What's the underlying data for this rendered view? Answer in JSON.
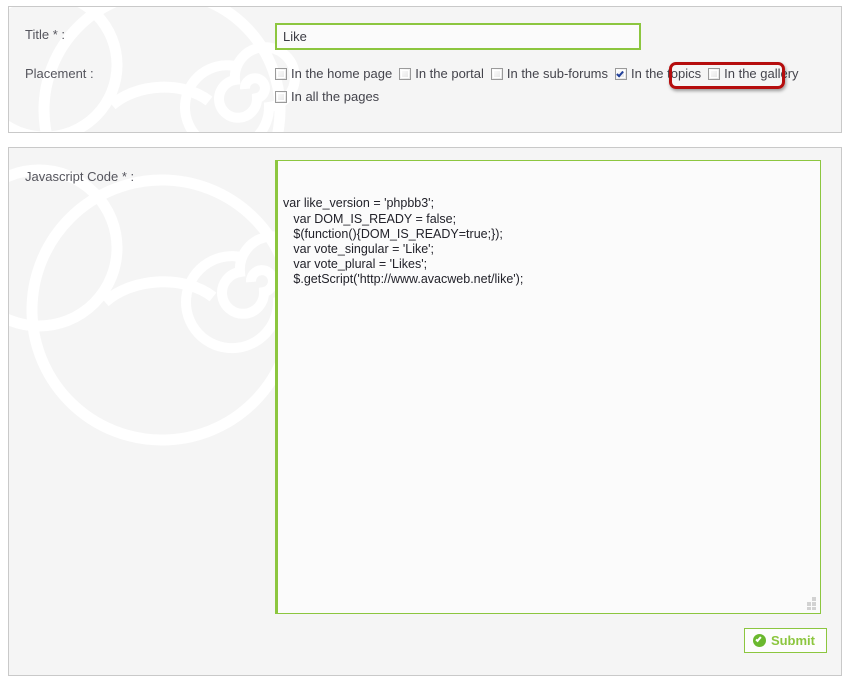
{
  "form": {
    "title_label": "Title * :",
    "title_value": "Like",
    "title_placeholder": "",
    "placement_label": "Placement :",
    "placement_options": [
      {
        "label": "In the home page",
        "checked": false
      },
      {
        "label": "In the portal",
        "checked": false
      },
      {
        "label": "In the sub-forums",
        "checked": false
      },
      {
        "label": "In the topics",
        "checked": true
      },
      {
        "label": "In the gallery",
        "checked": false
      },
      {
        "label": "In all the pages",
        "checked": false
      }
    ],
    "code_label": "Javascript Code * :",
    "code_value": "var like_version = 'phpbb3';\n   var DOM_IS_READY = false;\n   $(function(){DOM_IS_READY=true;});\n   var vote_singular = 'Like';\n   var vote_plural = 'Likes';\n   $.getScript('http://www.avacweb.net/like');",
    "submit_label": "Submit",
    "submit_icon": "check-circle-icon"
  },
  "annotation": {
    "target": "In the topics",
    "color": "#b50d0d"
  },
  "colors": {
    "accent_green": "#8cc63f",
    "panel_bg": "#f5f5f5",
    "panel_border": "#c9c9c9",
    "text": "#44444c"
  }
}
